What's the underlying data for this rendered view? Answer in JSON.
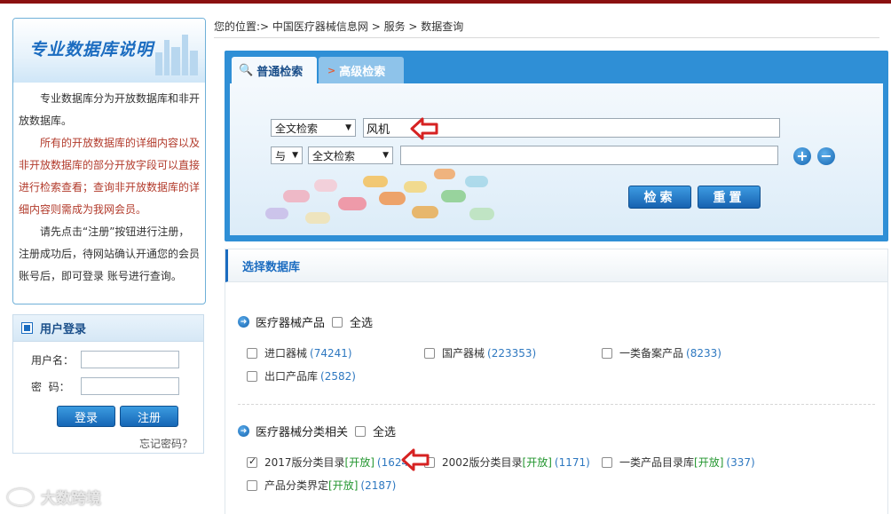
{
  "intro": {
    "title": "专业数据库说明",
    "para1": "专业数据库分为开放数据库和非开放数据库。",
    "para2": "所有的开放数据库的详细内容以及非开放数据库的部分开放字段可以直接进行检索查看；查询非开放数据库的详细内容则需成为我网会员。",
    "para3": "请先点击“注册”按钮进行注册，注册成功后，待网站确认开通您的会员账号后，即可登录 账号进行查询。"
  },
  "login": {
    "title": "用户登录",
    "username_label": "用户名：",
    "password_label": "密  码：",
    "login_button": "登录",
    "register_button": "注册",
    "forgot": "忘记密码？"
  },
  "breadcrumb": "您的位置:> 中国医疗器械信息网 > 服务 > 数据查询",
  "search": {
    "tab_normal": "普通检索",
    "tab_advanced": "高级检索",
    "field1": "全文检索",
    "query1": "风机",
    "logic": "与",
    "field2": "全文检索",
    "query2": "",
    "search_button": "检索",
    "reset_button": "重置"
  },
  "db": {
    "title": "选择数据库",
    "groups": [
      {
        "name": "医疗器械产品",
        "select_all": "全选",
        "items": [
          {
            "label": "进口器械",
            "count": "(74241)",
            "open": ""
          },
          {
            "label": "国产器械",
            "count": "(223353)",
            "open": ""
          },
          {
            "label": "一类备案产品",
            "count": "(8233)",
            "open": ""
          },
          {
            "label": "出口产品库",
            "count": "(2582)",
            "open": ""
          }
        ]
      },
      {
        "name": "医疗器械分类相关",
        "select_all": "全选",
        "items": [
          {
            "label": "2017版分类目录",
            "count": "(1624)",
            "open": "[开放]"
          },
          {
            "label": "2002版分类目录",
            "count": "(1171)",
            "open": "[开放]"
          },
          {
            "label": "一类产品目录库",
            "count": "(337)",
            "open": "[开放]"
          },
          {
            "label": "产品分类界定",
            "count": "(2187)",
            "open": "[开放]"
          }
        ]
      }
    ]
  },
  "watermark": "大数跨境"
}
